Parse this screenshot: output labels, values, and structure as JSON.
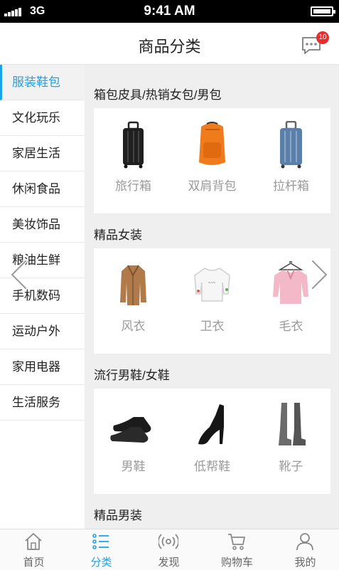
{
  "status_bar": {
    "carrier": "3G",
    "time": "9:41 AM"
  },
  "header": {
    "title": "商品分类",
    "message_badge": "10"
  },
  "sidebar": {
    "items": [
      {
        "label": "服装鞋包"
      },
      {
        "label": "文化玩乐"
      },
      {
        "label": "家居生活"
      },
      {
        "label": "休闲食品"
      },
      {
        "label": "美妆饰品"
      },
      {
        "label": "粮油生鲜"
      },
      {
        "label": "手机数码"
      },
      {
        "label": "运动户外"
      },
      {
        "label": "家用电器"
      },
      {
        "label": "生活服务"
      }
    ]
  },
  "sections": [
    {
      "title": "箱包皮具/热销女包/男包",
      "items": [
        {
          "label": "旅行箱"
        },
        {
          "label": "双肩背包"
        },
        {
          "label": "拉杆箱"
        }
      ]
    },
    {
      "title": "精品女装",
      "items": [
        {
          "label": "风衣"
        },
        {
          "label": "卫衣"
        },
        {
          "label": "毛衣"
        }
      ]
    },
    {
      "title": "流行男鞋/女鞋",
      "items": [
        {
          "label": "男鞋"
        },
        {
          "label": "低帮鞋"
        },
        {
          "label": "靴子"
        }
      ]
    },
    {
      "title": "精品男装"
    }
  ],
  "tabbar": {
    "tabs": [
      {
        "label": "首页"
      },
      {
        "label": "分类"
      },
      {
        "label": "发现"
      },
      {
        "label": "购物车"
      },
      {
        "label": "我的"
      }
    ]
  },
  "colors": {
    "accent": "#1aa3e8",
    "badge": "#e62e2e",
    "content_bg": "#efefef"
  }
}
